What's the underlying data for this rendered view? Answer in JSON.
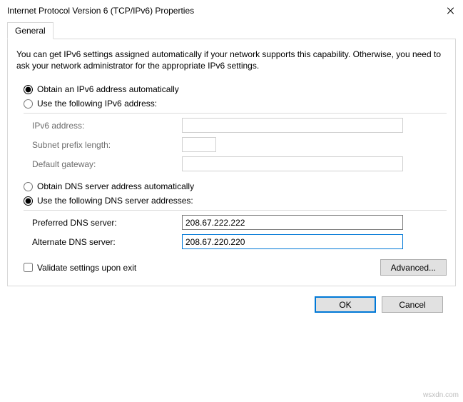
{
  "window": {
    "title": "Internet Protocol Version 6 (TCP/IPv6) Properties"
  },
  "tabs": {
    "general": "General"
  },
  "description": "You can get IPv6 settings assigned automatically if your network supports this capability. Otherwise, you need to ask your network administrator for the appropriate IPv6 settings.",
  "address_group": {
    "auto_label": "Obtain an IPv6 address automatically",
    "manual_label": "Use the following IPv6 address:",
    "fields": {
      "ipv6_address_label": "IPv6 address:",
      "ipv6_address_value": "",
      "subnet_prefix_label": "Subnet prefix length:",
      "subnet_prefix_value": "",
      "default_gateway_label": "Default gateway:",
      "default_gateway_value": ""
    }
  },
  "dns_group": {
    "auto_label": "Obtain DNS server address automatically",
    "manual_label": "Use the following DNS server addresses:",
    "fields": {
      "preferred_label": "Preferred DNS server:",
      "preferred_value": "208.67.222.222",
      "alternate_label": "Alternate DNS server:",
      "alternate_value": "208.67.220.220"
    }
  },
  "validate_label": "Validate settings upon exit",
  "buttons": {
    "advanced": "Advanced...",
    "ok": "OK",
    "cancel": "Cancel"
  },
  "watermark": "wsxdn.com"
}
